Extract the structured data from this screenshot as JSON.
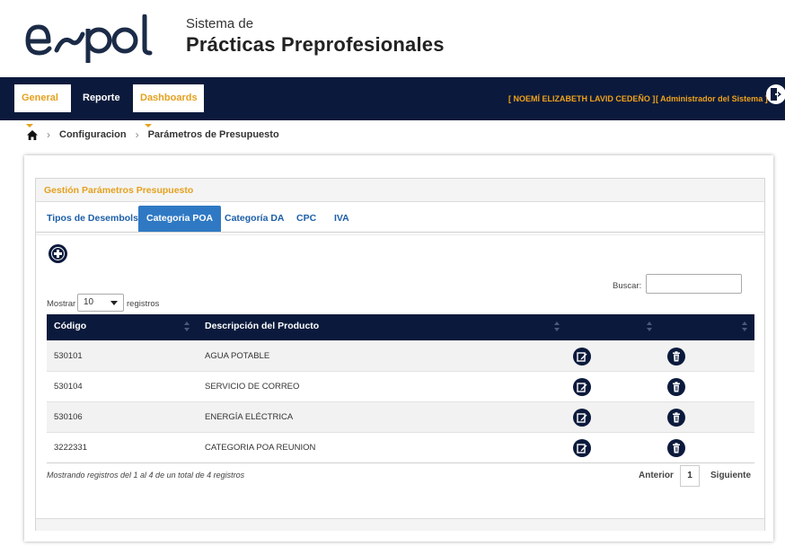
{
  "header": {
    "logo_text": "espol",
    "system_small": "Sistema de",
    "system_big": "Prácticas Preprofesionales"
  },
  "nav": {
    "general": "General",
    "reporte": "Reporte",
    "dashboards": "Dashboards",
    "user": "[ NOEMÍ ELIZABETH LAVID CEDEÑO ]",
    "role": "[ Administrador del Sistema ]"
  },
  "breadcrumb": {
    "home_icon": "home-icon",
    "items": [
      "Configuracion",
      "Parámetros de Presupuesto"
    ]
  },
  "panel": {
    "heading": "Gestión Parámetros Presupuesto",
    "tabs": [
      "Tipos de Desembolso",
      "Categoria POA",
      "Categoría DA",
      "CPC",
      "IVA"
    ],
    "active_tab": "Categoria POA"
  },
  "controls": {
    "search_label": "Buscar:",
    "search_value": "",
    "show_label": "Mostrar",
    "show_value": "10",
    "records_label": "registros"
  },
  "table": {
    "columns": [
      "Código",
      "Descripción del Producto",
      "",
      ""
    ],
    "rows": [
      {
        "code": "530101",
        "desc": "AGUA POTABLE"
      },
      {
        "code": "530104",
        "desc": "SERVICIO DE CORREO"
      },
      {
        "code": "530106",
        "desc": "ENERGÍA ELÉCTRICA"
      },
      {
        "code": "3222331",
        "desc": "CATEGORIA POA REUNION"
      }
    ]
  },
  "footer": {
    "info": "Mostrando registros del 1 al 4 de un total de 4 registros",
    "prev": "Anterior",
    "page": "1",
    "next": "Siguiente"
  },
  "colors": {
    "navy": "#0b1a3c",
    "orange": "#e5a11e",
    "tab_blue": "#2f79c4"
  }
}
